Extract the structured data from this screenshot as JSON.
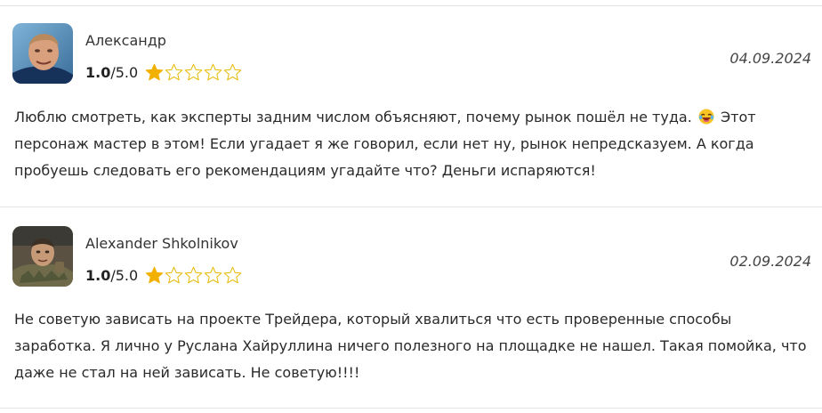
{
  "reviews": [
    {
      "author": "Александр",
      "rating_value": "1.0",
      "rating_max": "/5.0",
      "stars_filled": 1,
      "stars_total": 5,
      "date": "04.09.2024",
      "text_before_emoji": "Люблю смотреть, как эксперты задним числом объясняют, почему рынок пошёл не туда.",
      "emoji": "laughing-face-icon",
      "text_after_emoji": "Этот персонаж мастер в этом! Если угадает я же говорил, если нет ну, рынок непредсказуем. А когда пробуешь следовать его рекомендациям угадайте что? Деньги испаряются!"
    },
    {
      "author": "Alexander Shkolnikov",
      "rating_value": "1.0",
      "rating_max": "/5.0",
      "stars_filled": 1,
      "stars_total": 5,
      "date": "02.09.2024",
      "text": "Не советую зависать на проекте Трейдера, который хвалиться что есть проверенные способы заработка. Я лично у Руслана Хайруллина ничего полезного на площадке не нашел. Такая помойка, что даже не стал на ней зависать. Не советую!!!!"
    }
  ],
  "colors": {
    "star_filled": "#f2b100",
    "star_empty_stroke": "#e6b800",
    "divider": "#e3e3e3"
  }
}
